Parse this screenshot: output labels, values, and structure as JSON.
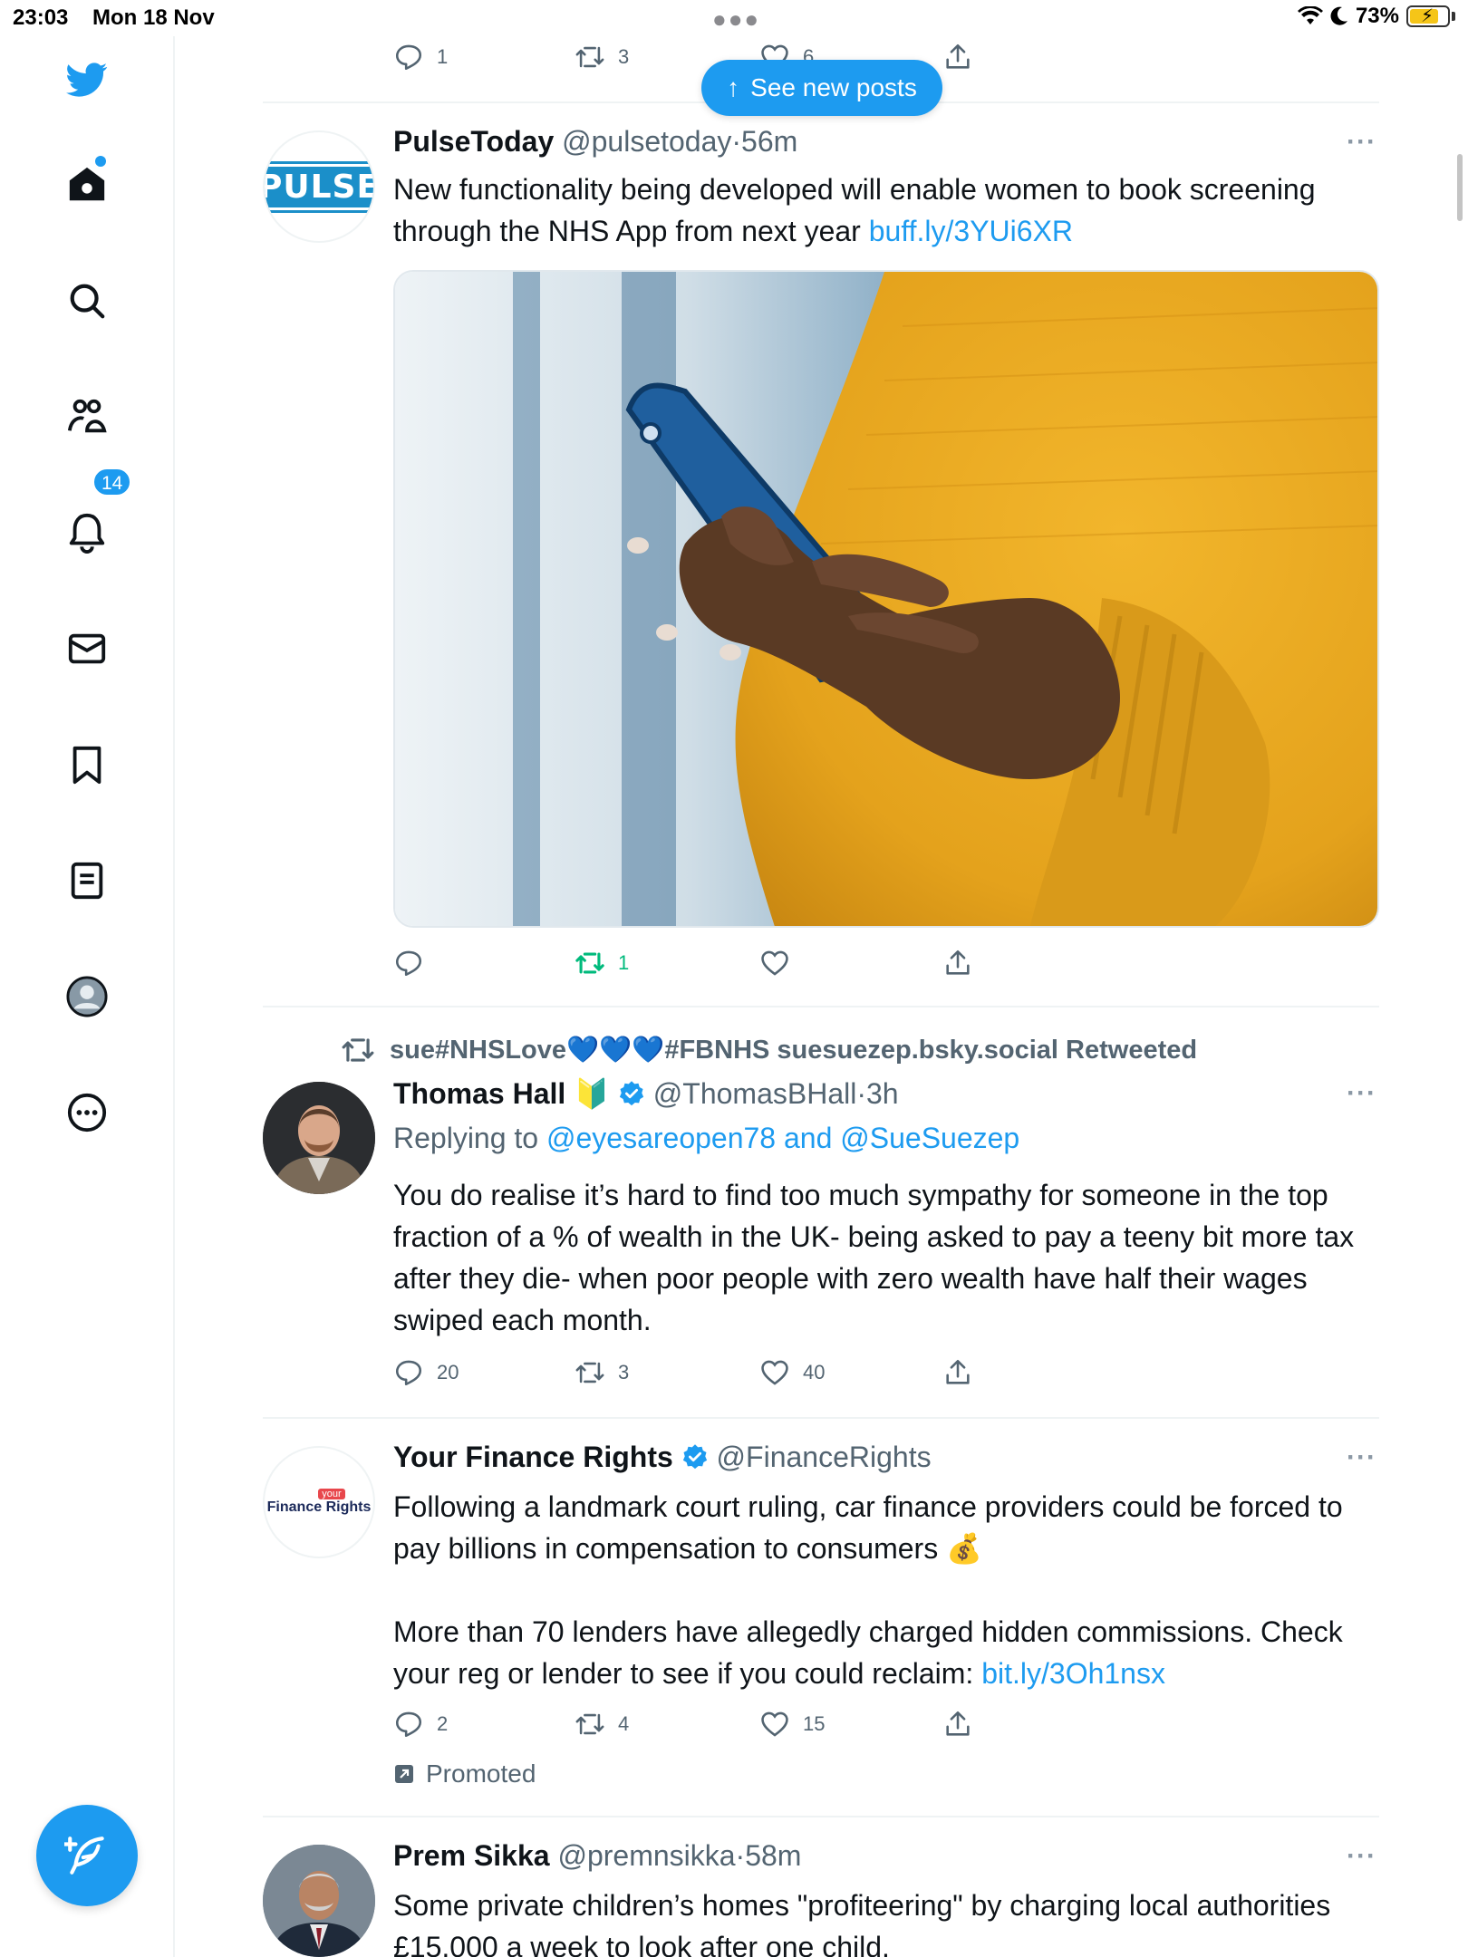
{
  "status_bar": {
    "time": "23:03",
    "date": "Mon 18 Nov",
    "battery": "73%"
  },
  "new_posts_pill": {
    "label": "See new posts"
  },
  "prev_tweet": {
    "replies": "1",
    "retweets": "3",
    "likes": "6"
  },
  "sidebar": {
    "notifications_badge": "14",
    "items": [
      "home",
      "search",
      "communities",
      "notifications",
      "messages",
      "bookmarks",
      "lists",
      "profile",
      "more"
    ]
  },
  "tweets": [
    {
      "name": "PulseToday",
      "handle": "@pulsetoday",
      "time": "56m",
      "avatar_text": "PULSE",
      "text": "New functionality being developed will enable women to book screening through the NHS App from next year",
      "link": "buff.ly/3YUi6XR",
      "replies": "",
      "retweets": "1",
      "likes": "",
      "retweeted_by_me": true
    },
    {
      "retweet_context": "sue#NHSLove💙💙💙#FBNHS suesuezep.bsky.social Retweeted",
      "name": "Thomas Hall",
      "name_emoji": "🔰",
      "verified": true,
      "handle": "@ThomasBHall",
      "time": "3h",
      "replying_prefix": "Replying to",
      "replying_to": "@eyesareopen78 and @SueSuezep",
      "text": "You do realise it’s hard to find too much sympathy for someone in the top fraction of a % of wealth in the UK- being asked to pay a teeny bit more tax after they die- when poor people with zero wealth have half their wages swiped each month.",
      "replies": "20",
      "retweets": "3",
      "likes": "40"
    },
    {
      "name": "Your Finance Rights",
      "verified": true,
      "handle": "@FinanceRights",
      "avatar_top": "your",
      "avatar_bottom": "Finance Rights",
      "text_1": "Following a landmark court ruling, car finance providers could be forced to pay billions in compensation to consumers 💰",
      "text_2": "More than 70 lenders have allegedly charged hidden commissions. Check your reg or lender to see if you could reclaim:",
      "link": "bit.ly/3Oh1nsx",
      "replies": "2",
      "retweets": "4",
      "likes": "15",
      "promoted_label": "Promoted"
    },
    {
      "name": "Prem Sikka",
      "handle": "@premnsikka",
      "time": "58m",
      "text": "Some private children’s homes \"profiteering\" by charging local authorities £15,000 a week to look after one child."
    }
  ],
  "separator": "·",
  "colors": {
    "accent": "#1d9bf0",
    "retweet_green": "#00ba7c",
    "muted": "#536471"
  }
}
